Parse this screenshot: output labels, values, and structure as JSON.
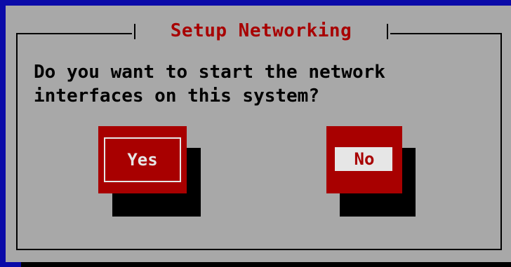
{
  "dialog": {
    "title": "Setup Networking",
    "message_line1": "Do you want to start the network",
    "message_line2": "interfaces on this system?"
  },
  "buttons": {
    "yes_label": "Yes",
    "no_label": "No"
  },
  "colors": {
    "screen_background": "#0a0aa8",
    "dialog_background": "#a8a8a8",
    "title_text": "#a80000",
    "button_background": "#a80000",
    "button_text": "#e6e6e6",
    "focused_button_highlight": "#e6e6e6",
    "shadow": "#000000"
  }
}
